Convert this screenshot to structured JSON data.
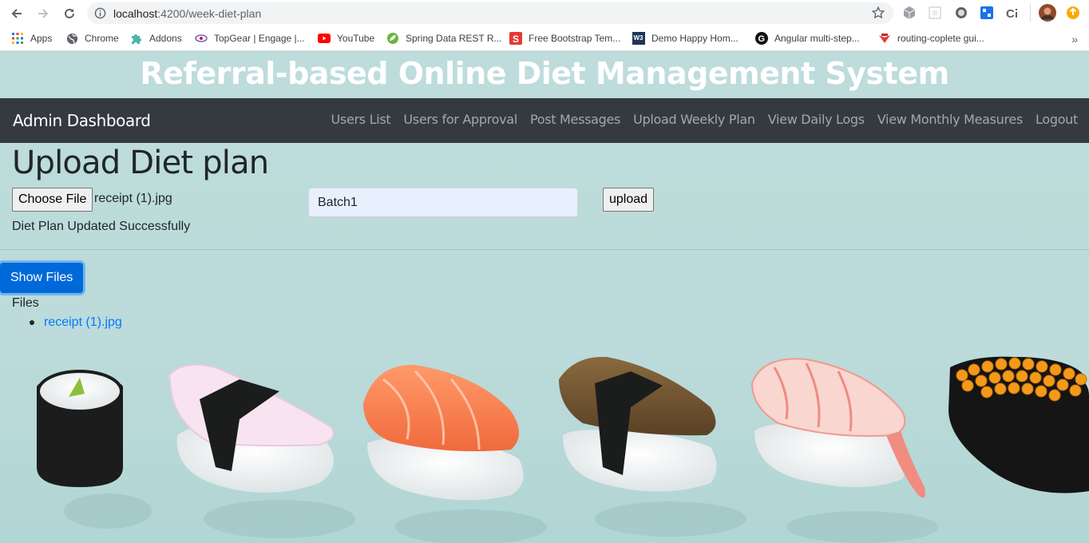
{
  "browser": {
    "url_host": "localhost",
    "url_path": ":4200/week-diet-plan",
    "bookmarks": [
      {
        "label": "Apps",
        "icon": "apps-grid-icon"
      },
      {
        "label": "Chrome",
        "icon": "globe-icon"
      },
      {
        "label": "Addons",
        "icon": "puzzle-icon"
      },
      {
        "label": "TopGear | Engage |...",
        "icon": "topgear-icon"
      },
      {
        "label": "YouTube",
        "icon": "youtube-icon"
      },
      {
        "label": "Spring Data REST R...",
        "icon": "spring-icon"
      },
      {
        "label": "Free Bootstrap Tem...",
        "icon": "bootstrap-s-icon"
      },
      {
        "label": "Demo Happy Hom...",
        "icon": "w3schools-icon"
      },
      {
        "label": "Angular multi-step...",
        "icon": "g-icon"
      },
      {
        "label": "routing-coplete gui...",
        "icon": "bookmark-icon"
      }
    ],
    "more_label": "»"
  },
  "app": {
    "banner_title": "Referral-based Online Diet Management System",
    "brand": "Admin Dashboard",
    "nav": [
      "Users List",
      "Users for Approval",
      "Post Messages",
      "Upload Weekly Plan",
      "View Daily Logs",
      "View Monthly Measures",
      "Logout"
    ]
  },
  "upload": {
    "heading": "Upload Diet plan",
    "choose_file_label": "Choose File",
    "chosen_file": "receipt (1).jpg",
    "batch_value": "Batch1",
    "upload_label": "upload",
    "status": "Diet Plan Updated Successfully"
  },
  "files": {
    "show_label": "Show Files",
    "heading": "Files",
    "items": [
      "receipt (1).jpg"
    ]
  },
  "colors": {
    "navbar": "#343a40",
    "primary": "#0069d9",
    "link": "#007bff",
    "page_bg": "#bcdbda"
  }
}
